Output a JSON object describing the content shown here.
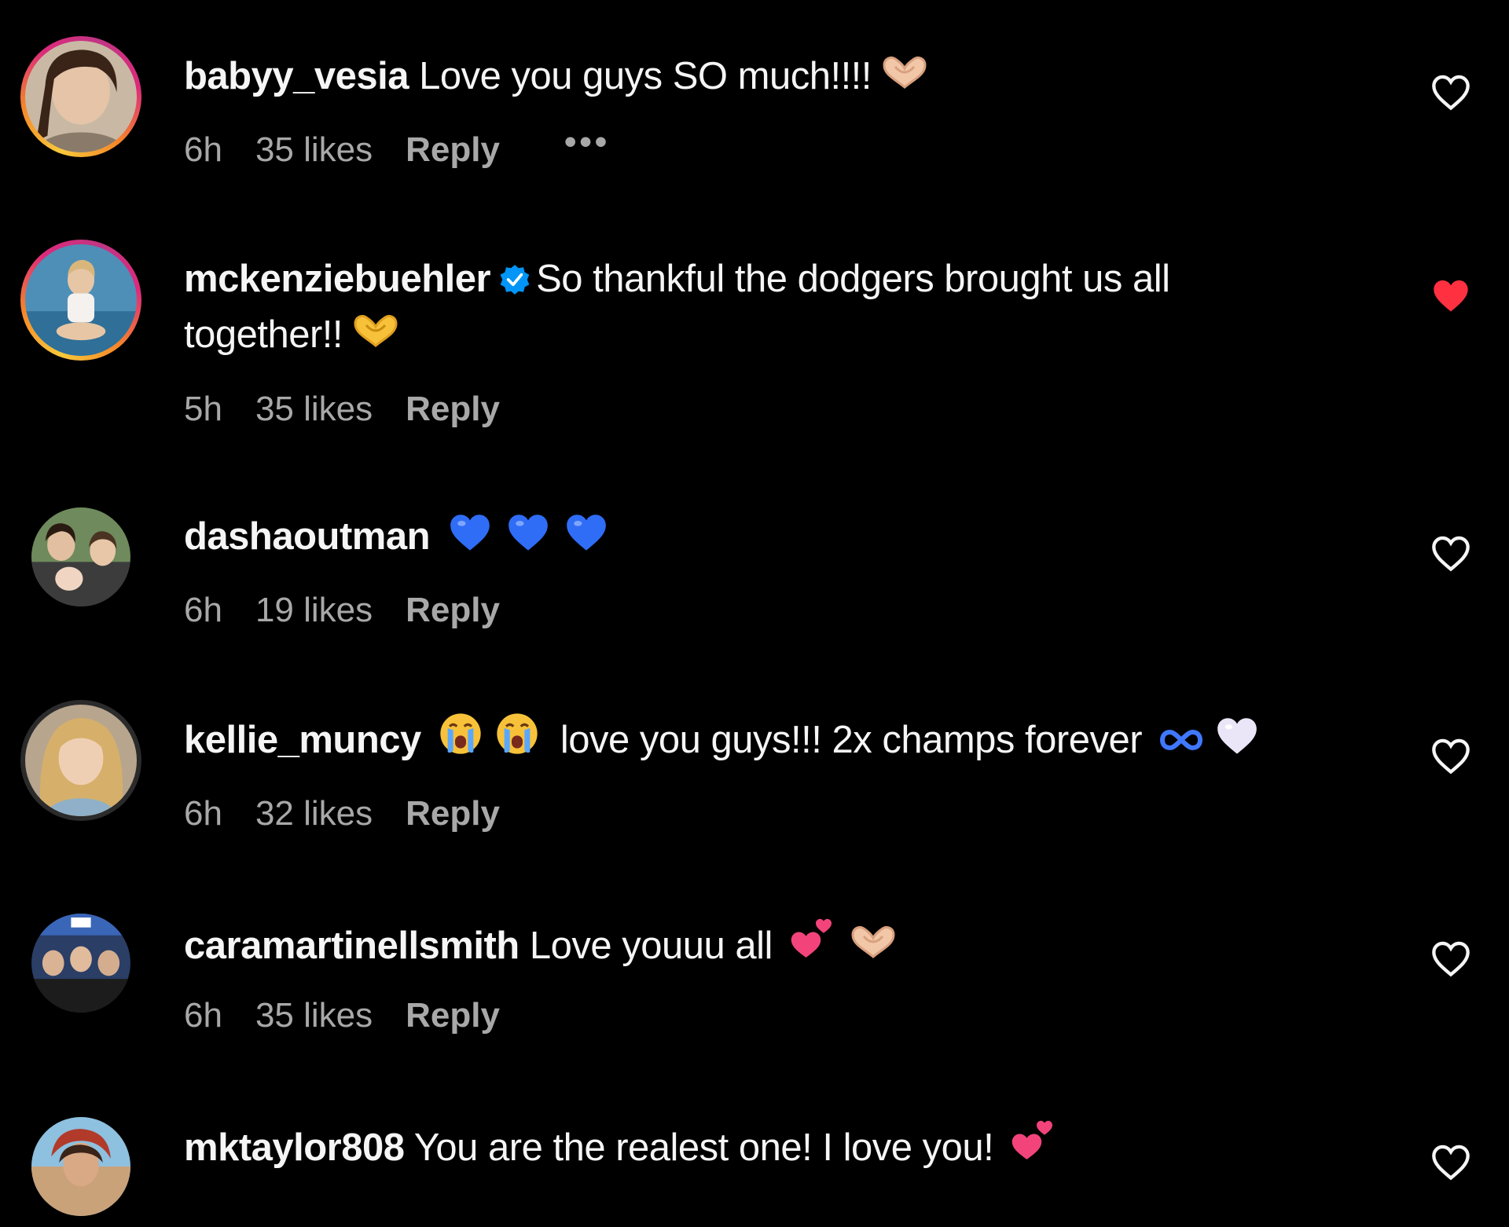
{
  "comments": [
    {
      "username": "babyy_vesia",
      "text": "Love you guys SO much!!!!",
      "emojis": [
        "heart-hands-emoji"
      ],
      "time": "6h",
      "likes": "35 likes",
      "reply": "Reply",
      "more": "•••",
      "liked": false,
      "ring": "story"
    },
    {
      "username": "mckenziebuehler",
      "verified": true,
      "text_line1": "So thankful the dodgers brought us all",
      "text_line2": "together!!",
      "emojis": [
        "heart-hands-emoji"
      ],
      "time": "5h",
      "likes": "35 likes",
      "reply": "Reply",
      "liked": true,
      "ring": "story"
    },
    {
      "username": "dashaoutman",
      "text": "",
      "emojis": [
        "blue-heart-emoji",
        "blue-heart-emoji",
        "blue-heart-emoji"
      ],
      "time": "6h",
      "likes": "19 likes",
      "reply": "Reply",
      "liked": false,
      "ring": "none"
    },
    {
      "username": "kellie_muncy",
      "text": "love you guys!!! 2x champs forever",
      "emojis_before": [
        "crying-face-emoji",
        "crying-face-emoji"
      ],
      "emojis_after": [
        "infinity-emoji",
        "white-heart-emoji"
      ],
      "time": "6h",
      "likes": "32 likes",
      "reply": "Reply",
      "liked": false,
      "ring": "seen"
    },
    {
      "username": "caramartinellsmith",
      "text": "Love youuu all",
      "emojis": [
        "two-hearts-emoji",
        "heart-hands-emoji"
      ],
      "time": "6h",
      "likes": "35 likes",
      "reply": "Reply",
      "liked": false,
      "ring": "none"
    },
    {
      "username": "mktaylor808",
      "text": "You are the realest one! I love you!",
      "emojis": [
        "two-hearts-emoji"
      ],
      "liked": false,
      "ring": "none"
    }
  ],
  "colors": {
    "background": "#000000",
    "text": "#f5f5f5",
    "meta": "#a8a8a8",
    "liked_heart": "#ff3040",
    "verified": "#0095f6"
  }
}
